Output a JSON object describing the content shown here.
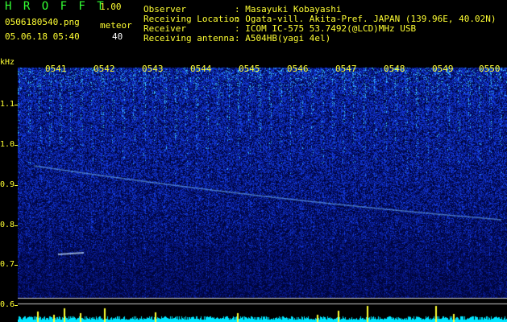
{
  "app": {
    "title": "H R O F F T",
    "version": "1.00"
  },
  "file": {
    "name": "0506180540.png",
    "datetime": "05.06.18 05:40"
  },
  "meteor": {
    "label": "meteor",
    "count": "40"
  },
  "info": {
    "labels": [
      "Observer",
      "Receiving Location",
      "Receiver",
      "Receiving antenna"
    ],
    "values": [
      ": Masayuki Kobayashi",
      ": Ogata-vill. Akita-Pref. JAPAN (139.96E, 40.02N)",
      ": ICOM IC-575 53.7492(@LCD)MHz USB",
      ": A504HB(yagi 4el)"
    ]
  },
  "axis": {
    "ylabel": "kHz",
    "yticks": [
      "1.1",
      "1.0",
      "0.9",
      "0.8",
      "0.7",
      "0.6"
    ],
    "xticks": [
      "0541",
      "0542",
      "0543",
      "0544",
      "0545",
      "0546",
      "0547",
      "0548",
      "0549",
      "0550"
    ]
  },
  "colors": {
    "background": "#000000",
    "noise": "#1a3cff",
    "signal": "#33ccff",
    "level": "#00ffff",
    "peak": "#ffff33",
    "label": "#ffff33"
  }
}
